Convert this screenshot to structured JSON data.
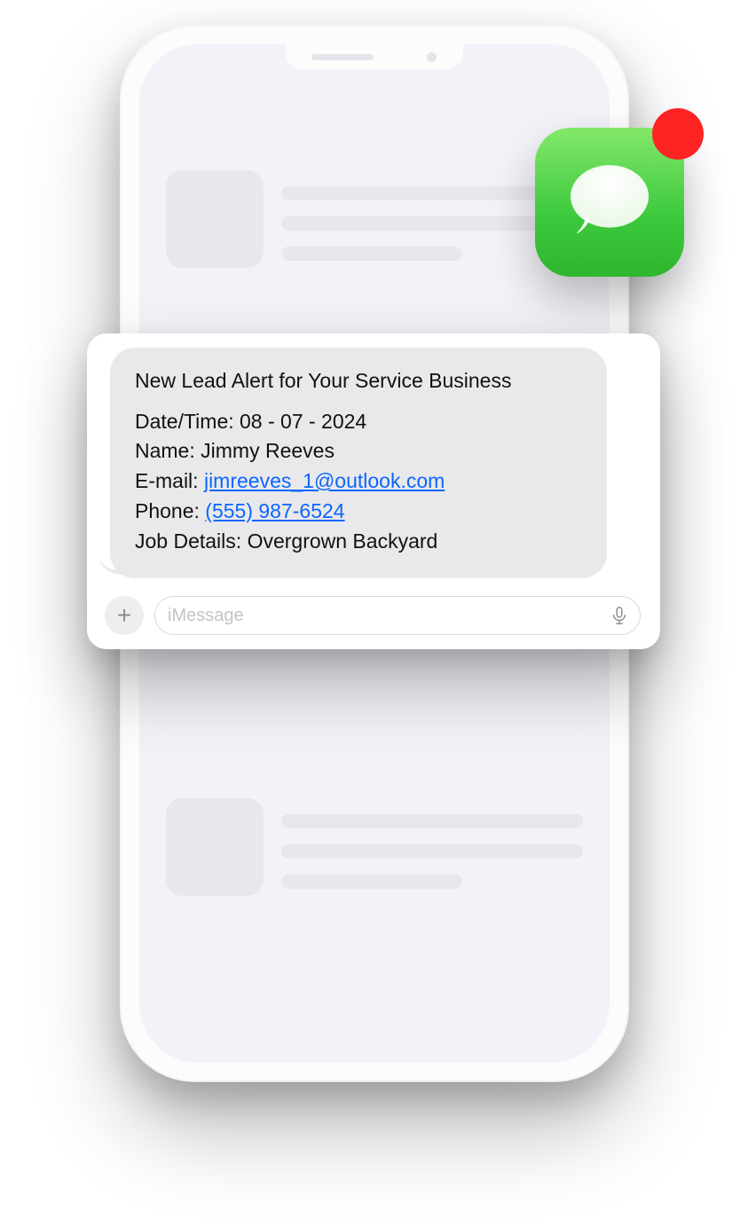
{
  "message": {
    "title": "New Lead Alert for Your Service Business",
    "date_label": "Date/Time: ",
    "date_value": "08 - 07 - 2024",
    "name_label": "Name: ",
    "name_value": "Jimmy Reeves",
    "email_label": "E-mail: ",
    "email_value": "jimreeves_1@outlook.com",
    "phone_label": "Phone: ",
    "phone_value": "(555) 987-6524",
    "job_label": "Job Details: ",
    "job_value": "Overgrown Backyard"
  },
  "input": {
    "placeholder": "iMessage",
    "plus": "+"
  }
}
